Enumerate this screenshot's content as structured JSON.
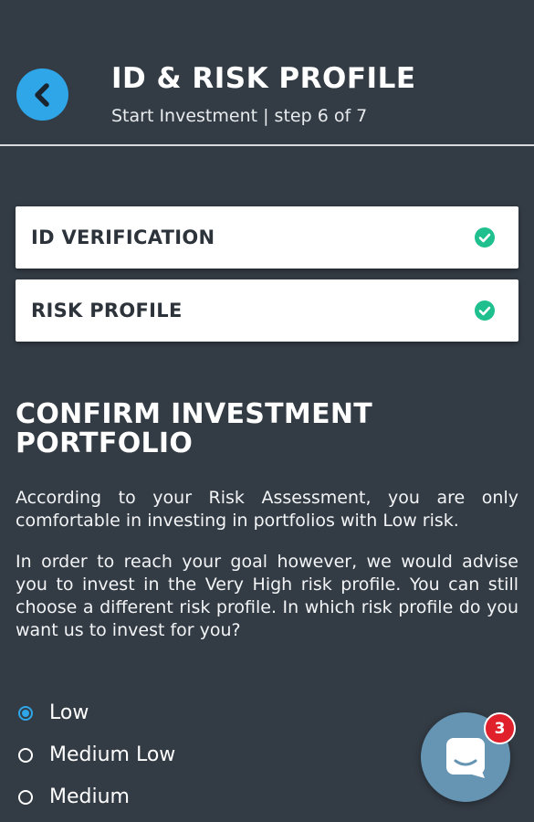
{
  "header": {
    "title": "ID & RISK PROFILE",
    "subtitle": "Start Investment | step 6 of 7"
  },
  "steps": [
    {
      "label": "ID VERIFICATION",
      "status": "complete",
      "icon": "check-circle-icon"
    },
    {
      "label": "RISK PROFILE",
      "status": "complete",
      "icon": "check-circle-icon"
    }
  ],
  "confirm": {
    "title": "CONFIRM INVESTMENT PORTFOLIO",
    "paragraph1": "According to your Risk Assessment, you are only comfortable in investing in portfolios with Low risk.",
    "paragraph2": "In order to reach your goal however, we would advise you to invest in the Very High risk profile. You can still choose a different risk profile. In which risk profile do you want us to invest for you?"
  },
  "options": [
    {
      "label": "Low",
      "selected": true
    },
    {
      "label": "Medium Low",
      "selected": false
    },
    {
      "label": "Medium",
      "selected": false
    }
  ],
  "chat": {
    "badge_count": "3",
    "icon": "chat-icon"
  },
  "colors": {
    "background": "#333b44",
    "accent": "#2fa6e8",
    "check": "#1fc08e",
    "badge": "#e0202a",
    "chat": "#6595b3"
  }
}
